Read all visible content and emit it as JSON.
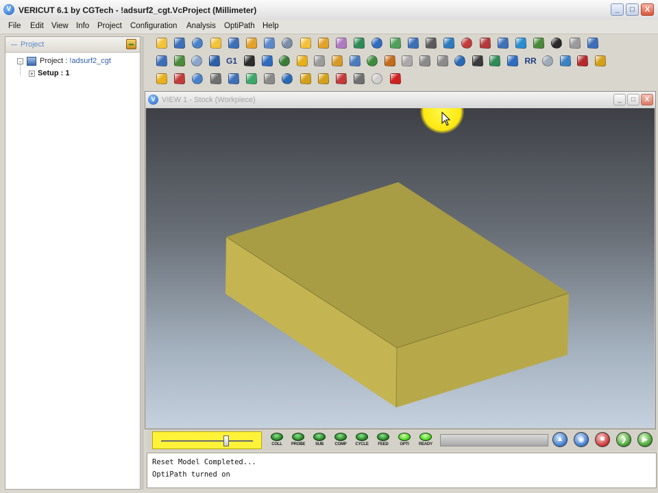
{
  "window": {
    "title": "VERICUT 6.1 by CGTech - !adsurf2_cgt.VcProject (Millimeter)",
    "logo_letter": "V",
    "btn_minimize": "_",
    "btn_maximize": "□",
    "btn_close": "X"
  },
  "menu": [
    {
      "label": "File"
    },
    {
      "label": "Edit"
    },
    {
      "label": "View"
    },
    {
      "label": "Info"
    },
    {
      "label": "Project"
    },
    {
      "label": "Configuration"
    },
    {
      "label": "Analysis"
    },
    {
      "label": "OptiPath"
    },
    {
      "label": "Help"
    }
  ],
  "project_panel": {
    "header": "Project",
    "tree": {
      "root_prefix": "Project :",
      "root_value": " !adsurf2_cgt",
      "child_label": "Setup : 1",
      "expander_minus": "-",
      "expander_plus": "+"
    }
  },
  "toolbar": {
    "g1_label": "G1",
    "rr_label": "RR",
    "row1_colors": [
      "#f3c23a",
      "#3d6fb8",
      "#4a82c9",
      "#f3c23a",
      "#3d6fb8",
      "#e2a12a",
      "#5b88c9",
      "#7d8ea6",
      "#f3c23a",
      "#e2a12a",
      "#b07ac0",
      "#2e8b57",
      "#2f6bbf",
      "#4f9f5a",
      "#3d6fb8",
      "#5b5b5b",
      "#2e7bbd",
      "#c23b3b",
      "#b33a3a",
      "#3f70b8",
      "#2b8ccf",
      "#4a8a3a",
      "#2a2a2a",
      "#9a9a9a",
      "#3d6fb8"
    ],
    "row2_colors": [
      "#3d6fb8",
      "#4a8a3a",
      "#8aa5c9",
      "#2e5fa8",
      "#3d3d3d",
      "#2c2c2c",
      "#2f6bbf",
      "#3a7d3a",
      "#e7b01a",
      "#9b9b9b",
      "#d79a2a",
      "#4b7bbf",
      "#3f8a3f",
      "#c46a1a",
      "#a9a9a9",
      "#8a8a8a",
      "#8a8a8a",
      "#2a6ab5",
      "#3a3a3a",
      "#2e8b57",
      "#2f6bbf",
      "#3b82c4",
      "#9fa9b8",
      "#3b82c4",
      "#b52b2b",
      "#d4a019"
    ],
    "row3_colors": [
      "#e7b01a",
      "#c23b3b",
      "#4a82c9",
      "#6f6f6f",
      "#3d6fb8",
      "#3ea66b",
      "#8a8a8a",
      "#2a6ab5",
      "#d4a019",
      "#d4a019",
      "#c23b3b",
      "#6f6f6f",
      "#cfcfcf",
      "#d12020"
    ]
  },
  "view": {
    "title": "VIEW 1 - Stock (Workpiece)",
    "logo_letter": "V",
    "btn_minimize": "_",
    "btn_maximize": "□",
    "btn_close": "X",
    "stock_colors": {
      "top": "#a89c45",
      "front": "#c4b552",
      "side": "#b7a94a"
    }
  },
  "sim_controls": {
    "slider_value": 0.75,
    "leds": [
      {
        "label": "COLL",
        "state": "off"
      },
      {
        "label": "PROBE",
        "state": "off"
      },
      {
        "label": "SUB",
        "state": "off"
      },
      {
        "label": "COMP",
        "state": "off"
      },
      {
        "label": "CYCLE",
        "state": "off"
      },
      {
        "label": "FEED",
        "state": "off"
      },
      {
        "label": "OPTI",
        "state": "on"
      },
      {
        "label": "READY",
        "state": "on"
      }
    ],
    "buttons": [
      "up-arrow",
      "rewind",
      "stop",
      "step",
      "play"
    ]
  },
  "log": {
    "lines": [
      "Reset Model Completed...",
      "OptiPath turned on"
    ]
  }
}
